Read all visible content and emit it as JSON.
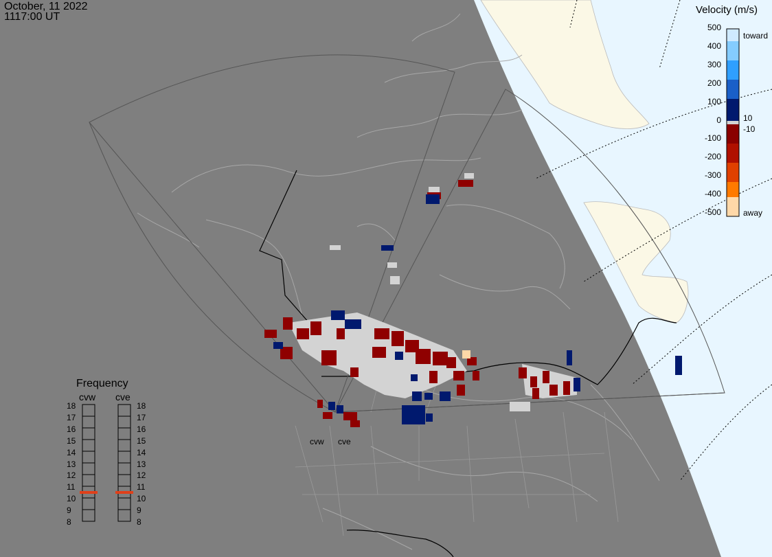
{
  "header": {
    "date": "October, 11 2022",
    "time": "1117:00 UT"
  },
  "colorbar": {
    "title": "Velocity (m/s)",
    "toward_label": "toward",
    "away_label": "away",
    "ticks": [
      "500",
      "400",
      "300",
      "200",
      "100",
      "0",
      "-100",
      "-200",
      "-300",
      "-400",
      "-500"
    ],
    "mid_upper": "10",
    "mid_lower": "-10",
    "colors_toward": [
      "#cfeaff",
      "#84ccff",
      "#2f9fff",
      "#1a5fc8",
      "#0a2f8f",
      "#00196e"
    ],
    "colors_away": [
      "#8a0000",
      "#a00000",
      "#c01a00",
      "#e04000",
      "#ff7a00",
      "#ffb070",
      "#ffd8a8"
    ]
  },
  "frequency": {
    "title": "Frequency",
    "columns": [
      "cvw",
      "cve"
    ],
    "levels": [
      "18",
      "17",
      "16",
      "15",
      "14",
      "13",
      "12",
      "11",
      "10",
      "9",
      "8"
    ],
    "active_level": 11,
    "active_color": "#e0401a"
  },
  "radars": {
    "west": "cvw",
    "east": "cve"
  },
  "colors": {
    "background": "#7f7f7f",
    "daylight_ocean": "#e8f6ff",
    "daylight_land": "#fbf8e6",
    "ground_scatter": "#d3d3d3",
    "positive": "#00196e",
    "negative": "#8f0000"
  }
}
